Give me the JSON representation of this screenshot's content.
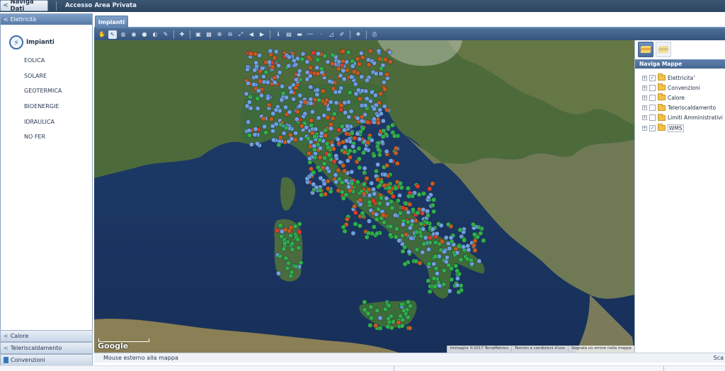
{
  "topbar": {
    "naviga_label": "Naviga Dati",
    "private_link": "Accesso Area Privata"
  },
  "left_panel": {
    "header": "Elettricità",
    "title": "Impianti",
    "items": [
      "EOLICA",
      "SOLARE",
      "GEOTERMICA",
      "BIOENERGIE",
      "IDRAULICA",
      "NO FER"
    ],
    "accordions": [
      "Calore",
      "Teleriscaldamento",
      "Convenzioni"
    ]
  },
  "tabs": {
    "active": "Impianti"
  },
  "map": {
    "google_label": "Google",
    "attribution": [
      "Immagini ©2017 TerraMetrics",
      "Termini e condizioni d'uso",
      "Segnala un errore nella mappe"
    ],
    "marker_colors": {
      "solare": "#6f9fe0",
      "eolica": "#2fb04a",
      "bioenergie": "#c85a1c",
      "idraulica": "#e03a2a",
      "area": "#d8c79a"
    }
  },
  "right_panel": {
    "header": "Naviga Mappe",
    "layers": [
      {
        "label": "Elettricita'",
        "checked": true
      },
      {
        "label": "Convenzioni",
        "checked": false
      },
      {
        "label": "Calore",
        "checked": false
      },
      {
        "label": "Teleriscaldamento",
        "checked": false
      },
      {
        "label": "Limiti Amministrativi",
        "checked": false
      },
      {
        "label": "WMS",
        "checked": true
      }
    ]
  },
  "status": {
    "text": "Mouse esterno alla mappa",
    "right": "Sca"
  }
}
